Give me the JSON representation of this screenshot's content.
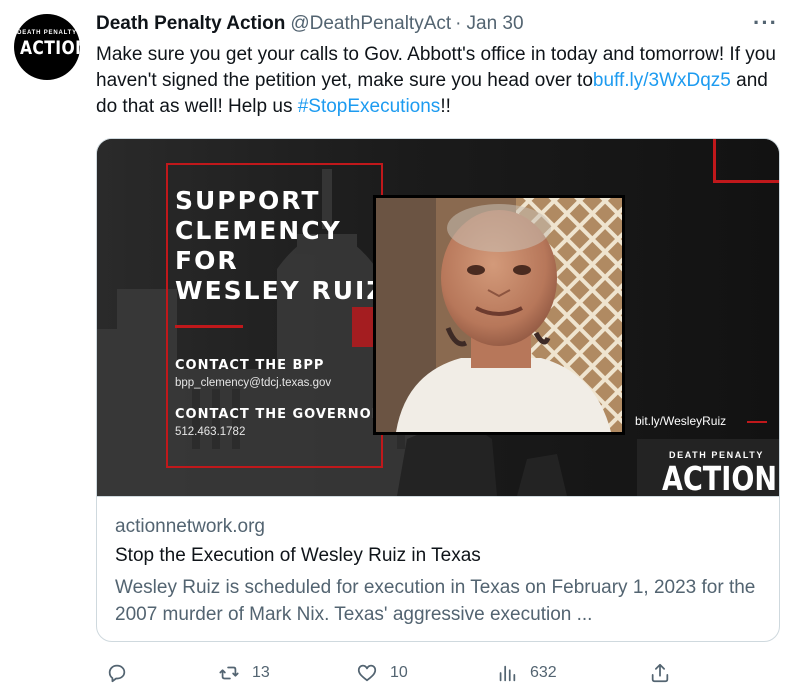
{
  "tweet": {
    "author_name": "Death Penalty Action",
    "handle": "@DeathPenaltyAct",
    "separator": "·",
    "date": "Jan 30",
    "more_label": "···",
    "text_part1": "Make sure you get your calls to Gov. Abbott's office in today and tomorrow! If you haven't signed the petition yet, make sure you head over to",
    "link": "buff.ly/3WxDqz5",
    "text_part2": " and do that as well! Help us ",
    "hashtag": "#StopExecutions",
    "text_part3": "!!"
  },
  "avatar": {
    "logo_small": "DEATH PENALTY",
    "logo_big": "ACTION"
  },
  "card": {
    "image": {
      "headline_lines": [
        "SUPPORT",
        "CLEMENCY",
        "FOR",
        "WESLEY RUIZ"
      ],
      "contact1_label": "CONTACT THE BPP",
      "contact1_value": "bpp_clemency@tdcj.texas.gov",
      "contact2_label": "CONTACT THE GOVERNOR",
      "contact2_value": "512.463.1782",
      "link": "bit.ly/WesleyRuiz",
      "logo_small": "DEATH PENALTY",
      "logo_big": "ACTION"
    },
    "domain": "actionnetwork.org",
    "title": "Stop the Execution of Wesley Ruiz in Texas",
    "description": "Wesley Ruiz is scheduled for execution in Texas on February 1, 2023 for the 2007 murder of Mark Nix. Texas' aggressive execution ..."
  },
  "actions": {
    "reply": {
      "icon": "reply-icon",
      "count": ""
    },
    "retweet": {
      "icon": "retweet-icon",
      "count": "13"
    },
    "like": {
      "icon": "heart-icon",
      "count": "10"
    },
    "views": {
      "icon": "views-icon",
      "count": "632"
    },
    "share": {
      "icon": "share-icon",
      "count": ""
    }
  },
  "colors": {
    "link": "#1d9bf0",
    "secondary_text": "#536471",
    "accent_red": "#c0181b",
    "border": "#cfd9de"
  }
}
